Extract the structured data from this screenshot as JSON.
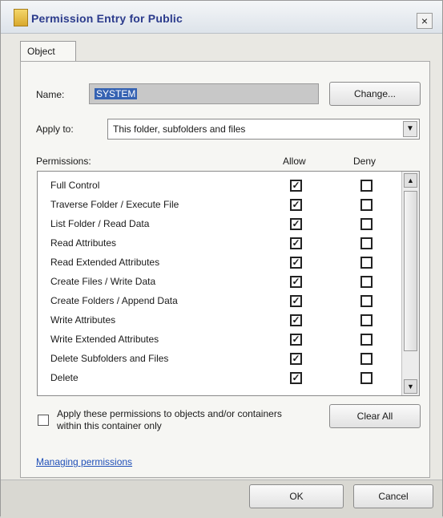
{
  "window": {
    "title": "Permission Entry for Public",
    "close_glyph": "×"
  },
  "tabs": [
    {
      "label": "Object"
    }
  ],
  "form": {
    "name_label": "Name:",
    "name_value": "SYSTEM",
    "change_button": "Change...",
    "apply_to_label": "Apply to:",
    "apply_to_value": "This folder, subfolders and files"
  },
  "permissions": {
    "header": "Permissions:",
    "allow_header": "Allow",
    "deny_header": "Deny",
    "items": [
      {
        "label": "Full Control",
        "allow": true,
        "deny": false
      },
      {
        "label": "Traverse Folder / Execute File",
        "allow": true,
        "deny": false
      },
      {
        "label": "List Folder / Read Data",
        "allow": true,
        "deny": false
      },
      {
        "label": "Read Attributes",
        "allow": true,
        "deny": false
      },
      {
        "label": "Read Extended Attributes",
        "allow": true,
        "deny": false
      },
      {
        "label": "Create Files / Write Data",
        "allow": true,
        "deny": false
      },
      {
        "label": "Create Folders / Append Data",
        "allow": true,
        "deny": false
      },
      {
        "label": "Write Attributes",
        "allow": true,
        "deny": false
      },
      {
        "label": "Write Extended Attributes",
        "allow": true,
        "deny": false
      },
      {
        "label": "Delete Subfolders and Files",
        "allow": true,
        "deny": false
      },
      {
        "label": "Delete",
        "allow": true,
        "deny": false
      }
    ]
  },
  "apply_inherit": {
    "label": "Apply these permissions to objects and/or containers within this container only",
    "checked": false
  },
  "clear_all_button": "Clear All",
  "managing_link": "Managing permissions",
  "footer": {
    "ok_button": "OK",
    "cancel_button": "Cancel"
  }
}
